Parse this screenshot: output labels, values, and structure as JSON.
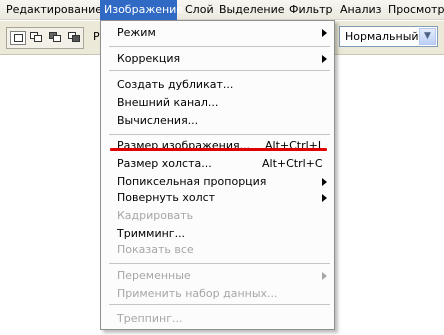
{
  "menubar": {
    "items": [
      {
        "label": "Редактирование"
      },
      {
        "label": "Изображение"
      },
      {
        "label": "Слой"
      },
      {
        "label": "Выделение"
      },
      {
        "label": "Фильтр"
      },
      {
        "label": "Анализ"
      },
      {
        "label": "Просмотр"
      }
    ],
    "active_index": 1,
    "active_color": "#316ac5"
  },
  "options": {
    "clipped_label": "P",
    "blend_partial_label": "N",
    "blend_mode_value": "Нормальный"
  },
  "menu": {
    "mode": {
      "label": "Режим"
    },
    "correction": {
      "label": "Коррекция"
    },
    "duplicate": {
      "label": "Создать дубликат..."
    },
    "external_channel": {
      "label": "Внешний канал..."
    },
    "calculations": {
      "label": "Вычисления..."
    },
    "image_size": {
      "label": "Размер изображения...",
      "shortcut": "Alt+Ctrl+I",
      "highlight_color": "#e00000"
    },
    "canvas_size": {
      "label": "Размер холста...",
      "shortcut": "Alt+Ctrl+C"
    },
    "pixel_aspect": {
      "label": "Попиксельная пропорция"
    },
    "rotate_canvas": {
      "label": "Повернуть холст"
    },
    "crop": {
      "label": "Кадрировать",
      "disabled": true
    },
    "trim": {
      "label": "Тримминг..."
    },
    "reveal_all": {
      "label": "Показать все",
      "disabled": true
    },
    "variables": {
      "label": "Переменные",
      "disabled": true
    },
    "apply_data_set": {
      "label": "Применить набор данных...",
      "disabled": true
    },
    "trap": {
      "label": "Треппинг...",
      "disabled": true
    }
  }
}
